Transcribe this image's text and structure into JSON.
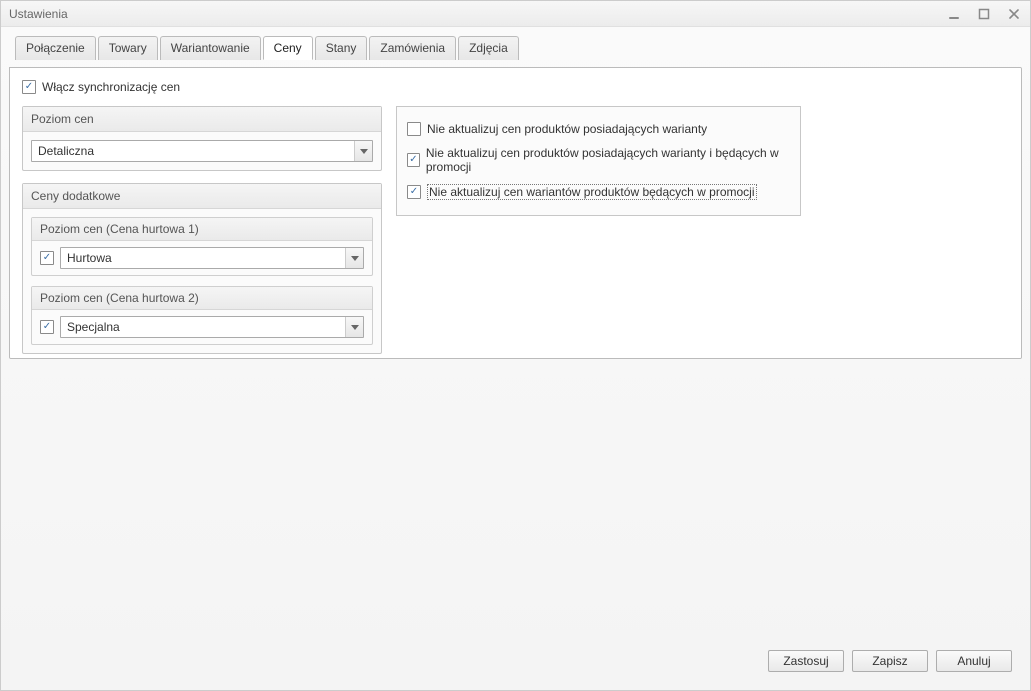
{
  "window": {
    "title": "Ustawienia"
  },
  "tabs": [
    {
      "label": "Połączenie"
    },
    {
      "label": "Towary"
    },
    {
      "label": "Wariantowanie"
    },
    {
      "label": "Ceny"
    },
    {
      "label": "Stany"
    },
    {
      "label": "Zamówienia"
    },
    {
      "label": "Zdjęcia"
    }
  ],
  "active_tab_index": 3,
  "sync": {
    "enable_label": "Włącz synchronizację cen",
    "enable_checked": true
  },
  "price_level": {
    "header": "Poziom cen",
    "value": "Detaliczna"
  },
  "additional_prices": {
    "header": "Ceny dodatkowe",
    "groups": [
      {
        "header": "Poziom cen (Cena hurtowa 1)",
        "checked": true,
        "value": "Hurtowa"
      },
      {
        "header": "Poziom cen (Cena hurtowa 2)",
        "checked": true,
        "value": "Specjalna"
      }
    ]
  },
  "options": [
    {
      "checked": false,
      "label": "Nie aktualizuj cen produktów posiadających warianty"
    },
    {
      "checked": true,
      "label": "Nie aktualizuj cen produktów posiadających warianty i będących w promocji"
    },
    {
      "checked": true,
      "label": "Nie aktualizuj cen wariantów produktów będących w promocji",
      "focused": true
    }
  ],
  "buttons": {
    "apply": "Zastosuj",
    "save": "Zapisz",
    "cancel": "Anuluj"
  }
}
